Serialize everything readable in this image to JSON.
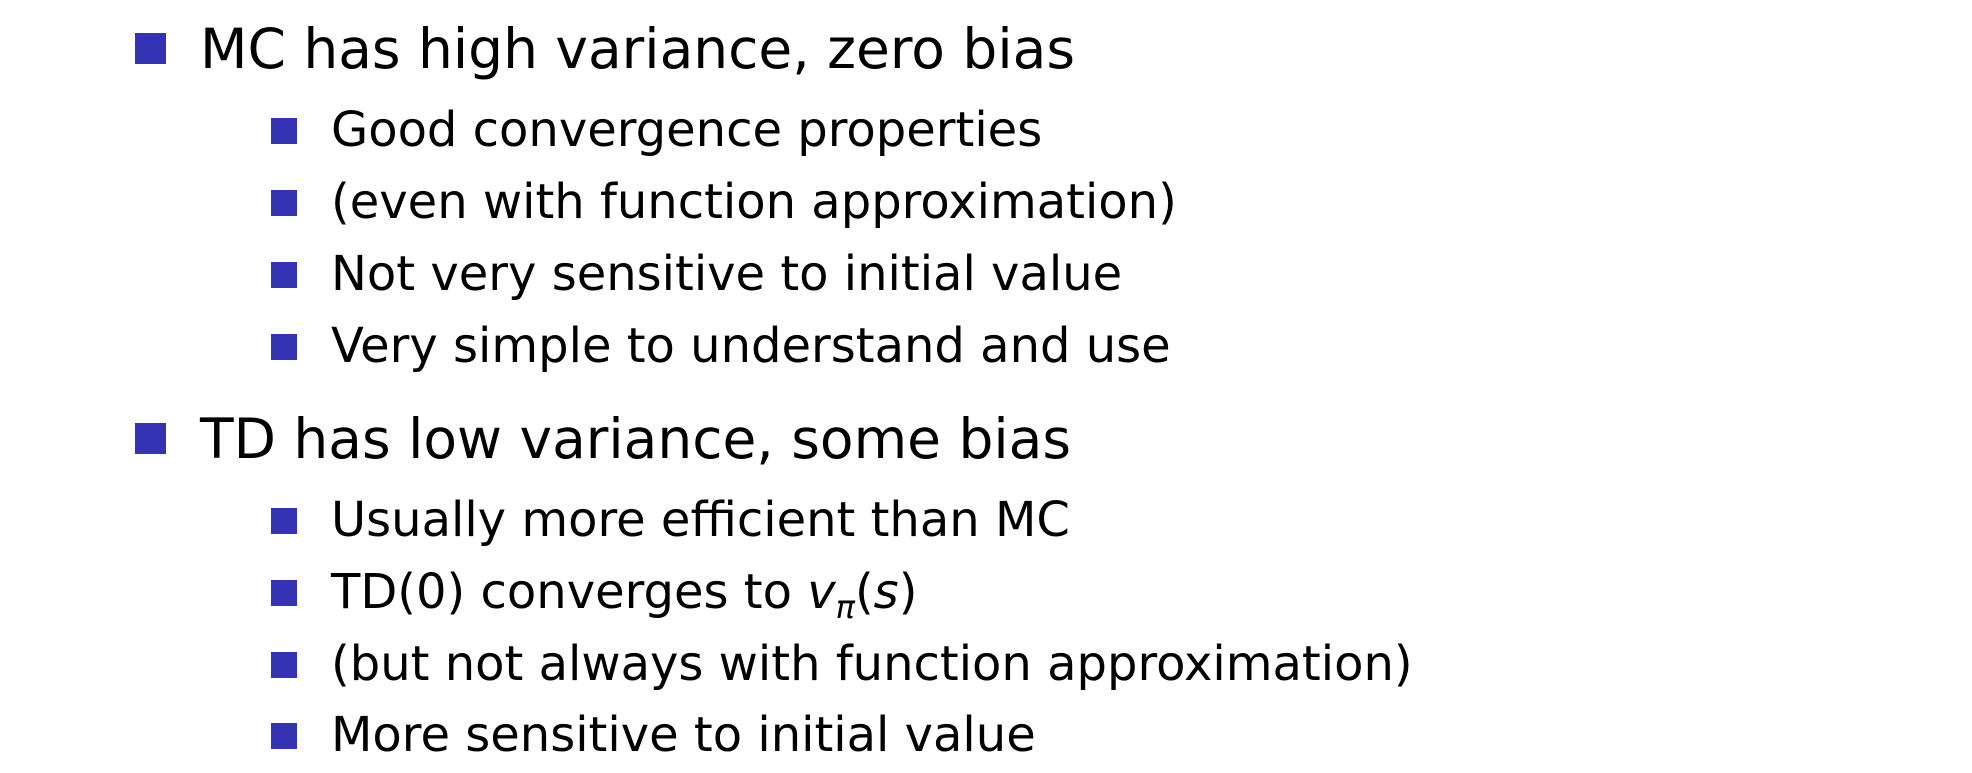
{
  "mc": {
    "heading": "MC has high variance, zero bias",
    "items": [
      "Good convergence properties",
      "(even with function approximation)",
      "Not very sensitive to initial value",
      "Very simple to understand and use"
    ]
  },
  "td": {
    "heading": "TD has low variance, some bias",
    "items": [
      "Usually more efficient than MC",
      "TD(0) converges to",
      "(but not always with function approximation)",
      "More sensitive to initial value"
    ],
    "math": {
      "v": "v",
      "sub": "π",
      "open": "(",
      "s": "s",
      "close": ")"
    }
  },
  "colors": {
    "bullet": "#3333b3",
    "text": "#000000",
    "background": "#ffffff"
  }
}
